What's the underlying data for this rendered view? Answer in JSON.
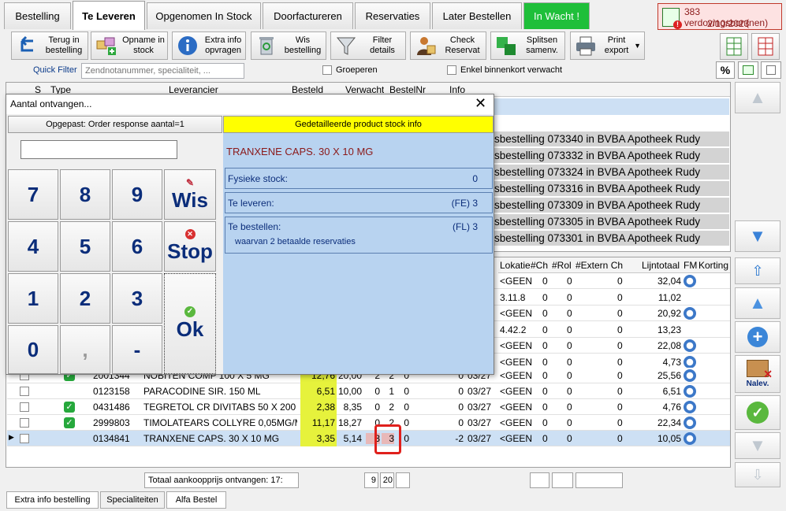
{
  "tabs": [
    "Bestelling",
    "Te Leveren",
    "Opgenomen In Stock",
    "Doorfactureren",
    "Reservaties",
    "Later Bestellen",
    "In Wacht !"
  ],
  "alert": {
    "line1": "383 verdovingsbon(nen)",
    "line2": "2/10/2023"
  },
  "toolbar": [
    {
      "line1": "Terug in",
      "line2": "bestelling"
    },
    {
      "line1": "Opname in",
      "line2": "stock"
    },
    {
      "line1": "Extra info",
      "line2": "opvragen"
    },
    {
      "line1": "Wis",
      "line2": "bestelling"
    },
    {
      "line1": "Filter",
      "line2": "details"
    },
    {
      "line1": "Check",
      "line2": "Reservat"
    },
    {
      "line1": "Splitsen",
      "line2": "samenv."
    },
    {
      "line1": "Print",
      "line2": "export"
    }
  ],
  "quickfilter": {
    "label": "Quick Filter",
    "placeholder": "Zendnotanummer, specialiteit, ..."
  },
  "groeperen": "Groeperen",
  "enkel": "Enkel binnenkort verwacht",
  "percent": "%",
  "upper_headers": [
    "S",
    "Type",
    "Leverancier",
    "Besteld",
    "Verwacht",
    "BestelNr",
    "Info"
  ],
  "upper_rows": [
    "sbestelling 073340 in BVBA Apotheek Rudy",
    "sbestelling 073332 in BVBA Apotheek Rudy",
    "sbestelling 073324 in BVBA Apotheek Rudy",
    "sbestelling 073316 in BVBA Apotheek Rudy",
    "sbestelling 073309 in BVBA Apotheek Rudy",
    "sbestelling 073305 in BVBA Apotheek Rudy",
    "sbestelling 073301 in BVBA Apotheek Rudy"
  ],
  "lower_headers": [
    "Lokatie",
    "#Ch",
    "#Rol",
    "#Extern Ch",
    "Lijntotaal",
    "FM",
    "Korting"
  ],
  "lower_partial_rows": [
    {
      "lok": "<GEEN",
      "ch": "0",
      "rol": "0",
      "ext": "0",
      "tot": "32,04",
      "fm": true
    },
    {
      "lok": "3.11.8",
      "ch": "0",
      "rol": "0",
      "ext": "0",
      "tot": "11,02",
      "fm": false
    },
    {
      "lok": "<GEEN",
      "ch": "0",
      "rol": "0",
      "ext": "0",
      "tot": "20,92",
      "fm": true
    },
    {
      "lok": "4.42.2",
      "ch": "0",
      "rol": "0",
      "ext": "0",
      "tot": "13,23",
      "fm": false
    },
    {
      "lok": "<GEEN",
      "ch": "0",
      "rol": "0",
      "ext": "0",
      "tot": "22,08",
      "fm": true
    },
    {
      "lok": "<GEEN",
      "ch": "0",
      "rol": "0",
      "ext": "0",
      "tot": "4,73",
      "fm": true
    }
  ],
  "lower_rows": [
    {
      "code": "2001344",
      "name": "NOBITEN COMP 100 X 5 MG",
      "price": "12,76",
      "total": "20,00",
      "a": "2",
      "b": "2",
      "c": "0",
      "d": "0",
      "date": "03/27",
      "lok": "<GEEN",
      "ch": "0",
      "rol": "0",
      "ext": "0",
      "tot": "25,56",
      "green": true,
      "sel": false
    },
    {
      "code": "0123158",
      "name": "PARACODINE SIR. 150 ML",
      "price": "6,51",
      "total": "10,00",
      "a": "0",
      "b": "1",
      "c": "0",
      "d": "0",
      "date": "03/27",
      "lok": "<GEEN",
      "ch": "0",
      "rol": "0",
      "ext": "0",
      "tot": "6,51",
      "green": false,
      "sel": false
    },
    {
      "code": "0431486",
      "name": "TEGRETOL CR DIVITABS 50 X 200",
      "price": "2,38",
      "total": "8,35",
      "a": "0",
      "b": "2",
      "c": "0",
      "d": "0",
      "date": "03/27",
      "lok": "<GEEN",
      "ch": "0",
      "rol": "0",
      "ext": "0",
      "tot": "4,76",
      "green": true,
      "sel": false
    },
    {
      "code": "2999803",
      "name": "TIMOLATEARS COLLYRE 0,05MG/M",
      "price": "11,17",
      "total": "18,27",
      "a": "0",
      "b": "2",
      "c": "0",
      "d": "0",
      "date": "03/27",
      "lok": "<GEEN",
      "ch": "0",
      "rol": "0",
      "ext": "0",
      "tot": "22,34",
      "green": true,
      "sel": false
    },
    {
      "code": "0134841",
      "name": "TRANXENE CAPS.  30 X 10 MG",
      "price": "3,35",
      "total": "5,14",
      "a": "3",
      "b": "3",
      "c": "0",
      "d": "-2",
      "date": "03/27",
      "lok": "<GEEN",
      "ch": "0",
      "rol": "0",
      "ext": "0",
      "tot": "10,05",
      "green": false,
      "sel": true
    }
  ],
  "footer": {
    "label": "Totaal aankoopprijs ontvangen: 17:",
    "n1": "9",
    "n2": "20"
  },
  "nalev": "Nalev.",
  "bottom_tabs": [
    "Extra info bestelling",
    "Specialiteiten",
    "Alfa Bestel"
  ],
  "dialog": {
    "title": "Aantal ontvangen...",
    "left_header": "Opgepast: Order response aantal=1",
    "right_header": "Gedetailleerde product stock info",
    "input_value": "",
    "keys": [
      "7",
      "8",
      "9",
      "4",
      "5",
      "6",
      "1",
      "2",
      "3",
      "0",
      ",",
      "-"
    ],
    "wis": "Wis",
    "stop": "Stop",
    "ok": "Ok",
    "product": "TRANXENE CAPS.  30 X 10 MG",
    "fysieke_label": "Fysieke stock:",
    "fysieke_value": "0",
    "leveren_label": "Te leveren:",
    "leveren_value": "(FE) 3",
    "bestellen_label": "Te bestellen:",
    "bestellen_value": "(FL) 3",
    "bestellen_sub": "waarvan  2 betaalde reservaties"
  },
  "colors": {
    "green_tab": "#1fbf3a",
    "yellow_header": "#ffff00",
    "info_blue": "#b8d3f0",
    "price_yellow": "#e6f23c",
    "highlight_red": "#e0201c"
  }
}
